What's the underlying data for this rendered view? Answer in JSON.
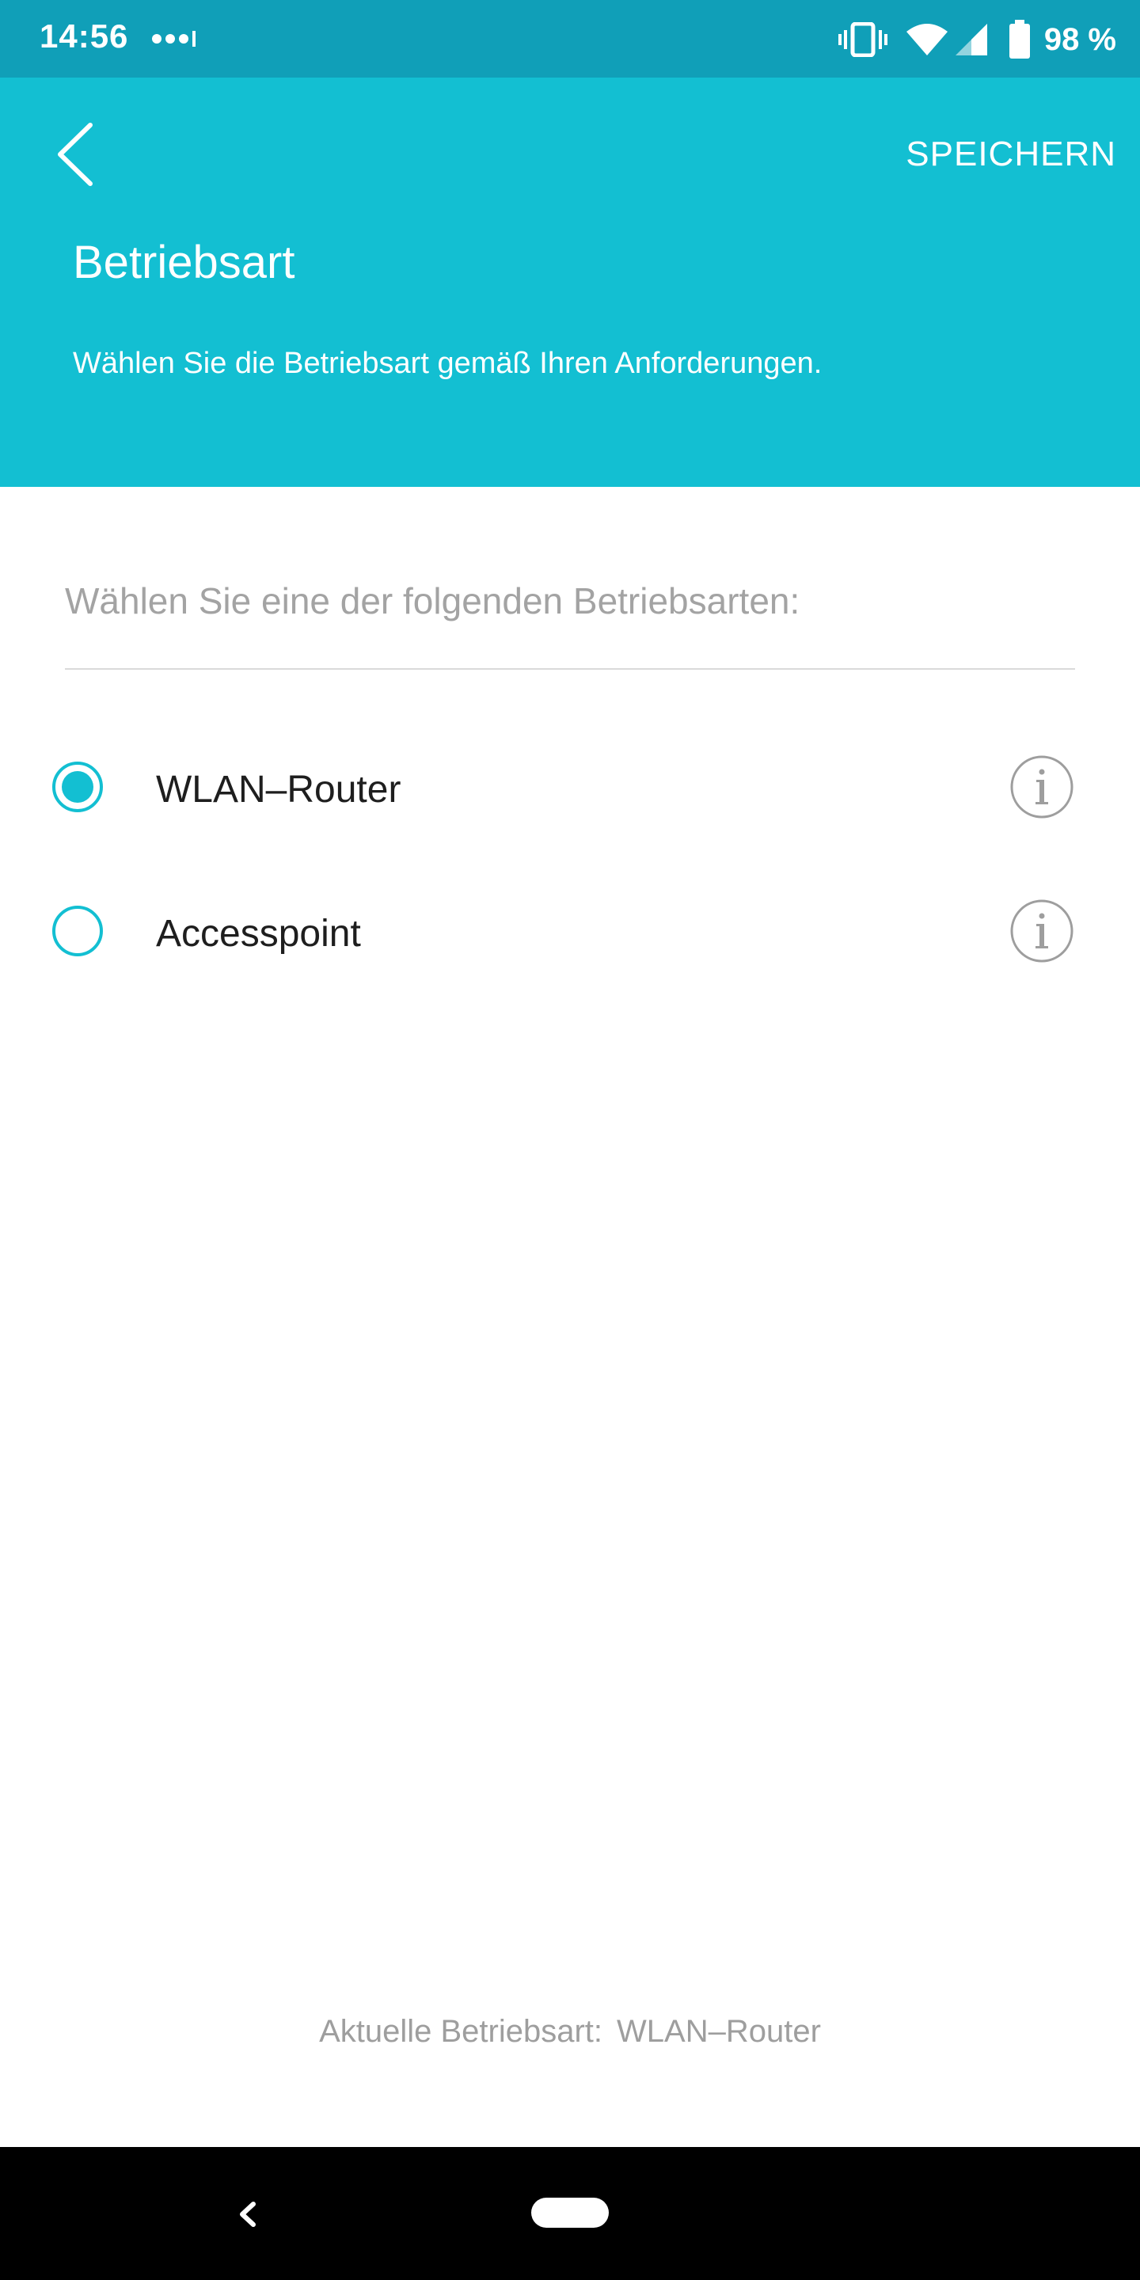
{
  "status_bar": {
    "time": "14:56",
    "battery_percent": "98 %",
    "icons": [
      "notification-dots-icon",
      "vibrate-icon",
      "wifi-icon",
      "cell-signal-icon",
      "battery-icon"
    ]
  },
  "header": {
    "save_label": "SPEICHERN",
    "title": "Betriebsart",
    "description": "Wählen Sie die Betriebsart gemäß Ihren Anforderungen.",
    "background_color": "#13bfd2",
    "status_bar_color": "#109fb8"
  },
  "content": {
    "prompt": "Wählen Sie eine der folgenden Betriebsarten:",
    "options": [
      {
        "label": "WLAN–Router",
        "selected": true
      },
      {
        "label": "Accesspoint",
        "selected": false
      }
    ],
    "accent_color": "#13bfd2"
  },
  "footer": {
    "current_mode_label": "Aktuelle Betriebsart:",
    "current_mode_value": "WLAN–Router"
  },
  "nav_bar": {
    "icons": [
      "nav-back-icon",
      "nav-home-pill"
    ]
  }
}
